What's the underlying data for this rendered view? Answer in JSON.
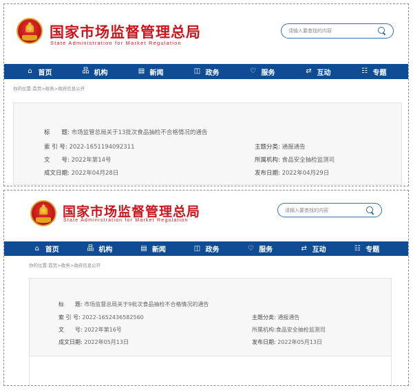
{
  "site": {
    "title_cn": "国家市场监督管理总局",
    "title_en": "State Administration for Market Regulation",
    "search_placeholder": "请输入要查找的内容"
  },
  "nav": [
    {
      "label": "首页",
      "icon": "home-icon",
      "glyph": "⌂"
    },
    {
      "label": "机构",
      "icon": "organization-icon",
      "glyph": "品"
    },
    {
      "label": "新闻",
      "icon": "news-icon",
      "glyph": "▤"
    },
    {
      "label": "政务",
      "icon": "government-affairs-icon",
      "glyph": "◫"
    },
    {
      "label": "服务",
      "icon": "heart-icon",
      "glyph": "♡"
    },
    {
      "label": "互动",
      "icon": "exchange-icon",
      "glyph": "⇄"
    },
    {
      "label": "专题",
      "icon": "topics-icon",
      "glyph": "☷"
    }
  ],
  "breadcrumb": "你的位置:首页>政务>政府信息公开",
  "labels": {
    "title": "标　　题:",
    "index": "索 引 号:",
    "doc_no": "文　　号:",
    "created": "成文日期:",
    "category": "主题分类:",
    "agency": "所属机构:",
    "published": "发布日期:"
  },
  "documents": [
    {
      "title": "市场监管总局关于13批次食品抽检不合格情况的通告",
      "index": "2022-1651194092311",
      "doc_no": "2022年第14号",
      "created": "2022年04月28日",
      "category": "通报通告",
      "agency": "食品安全抽检监测司",
      "published": "2022年04月29日"
    },
    {
      "title": "市场监督总局关于9批次食品抽检不合格情况的通告",
      "index": "2022-1652436582560",
      "doc_no": "2022年第16号",
      "created": "2022年05月13日",
      "category": "通报通告",
      "agency": "所属机构:食品安全抽检监测司",
      "published": "2022年05月13日"
    }
  ],
  "colors": {
    "brand_red": "#c8161d",
    "nav_blue": "#0f4c93",
    "search_border": "#2f6fb5"
  }
}
